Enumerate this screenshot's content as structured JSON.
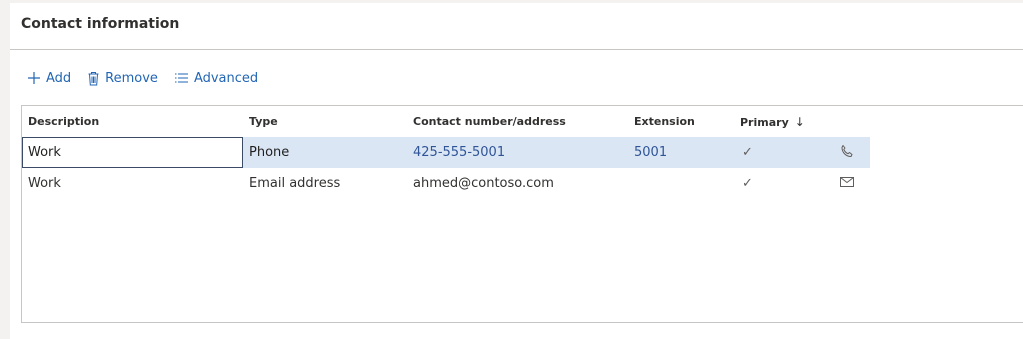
{
  "section": {
    "title": "Contact information"
  },
  "toolbar": {
    "add_label": "Add",
    "remove_label": "Remove",
    "advanced_label": "Advanced"
  },
  "grid": {
    "columns": {
      "description": "Description",
      "type": "Type",
      "contact": "Contact number/address",
      "extension": "Extension",
      "primary": "Primary",
      "primary_sort_icon": "↓"
    },
    "rows": [
      {
        "description": "Work",
        "type": "Phone",
        "contact": "425-555-5001",
        "extension": "5001",
        "primary_mark": "✓",
        "type_icon": "phone-icon",
        "selected": true
      },
      {
        "description": "Work",
        "type": "Email address",
        "contact": "ahmed@contoso.com",
        "extension": "",
        "primary_mark": "✓",
        "type_icon": "mail-icon",
        "selected": false
      }
    ]
  },
  "colors": {
    "accent": "#2266b4",
    "selected_row": "#dbe6f5",
    "border": "#c8c6c4"
  }
}
